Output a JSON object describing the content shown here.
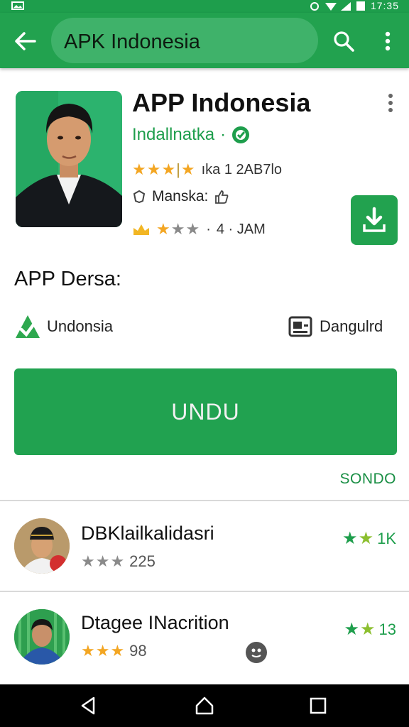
{
  "status_bar": {
    "time": "17:35"
  },
  "app_bar": {
    "search_title": "APK Indonesia"
  },
  "app": {
    "name": "APP Indonesia",
    "developer": "Indallnatka",
    "developer_suffix": "·",
    "rating_text": "ıka 1 2AB7lo",
    "maker_label": "Manska:",
    "meta_dot": "·",
    "meta_value": "4 · JAM"
  },
  "description": {
    "title": "APP Dersa:",
    "left_info": "Undonsia",
    "right_info": "Dangulrd"
  },
  "main_button": {
    "label": "UNDU"
  },
  "more_link": "SONDO",
  "list": [
    {
      "title": "DBKlailkalidasri",
      "rating_value": "225",
      "right_value": "1K"
    },
    {
      "title": "Dtagee INacrition",
      "rating_value": "98",
      "right_value": "13"
    }
  ],
  "colors": {
    "brand_green": "#22a24f",
    "star_orange": "#f3a623"
  }
}
